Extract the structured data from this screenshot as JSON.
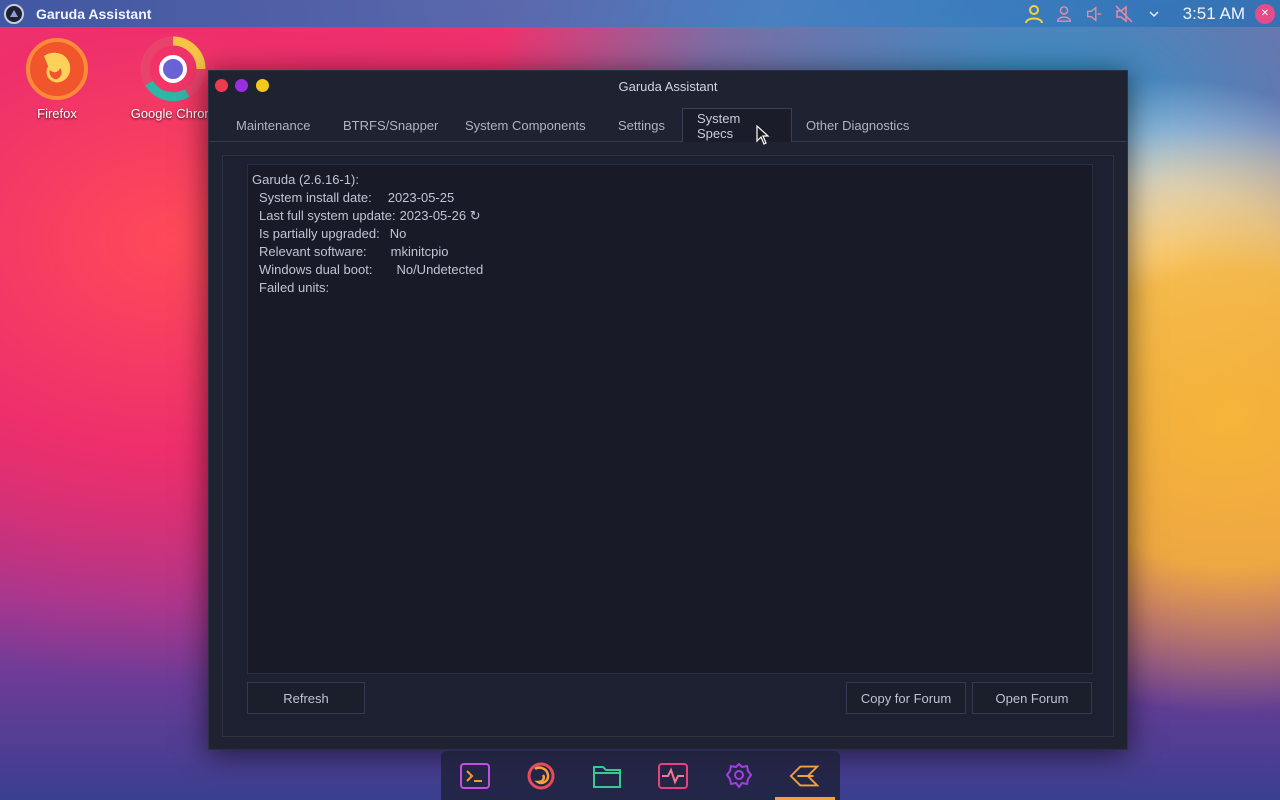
{
  "top_panel": {
    "active_app_title": "Garuda Assistant",
    "clock": "3:51 AM",
    "tray_icons": [
      "user-icon",
      "person-icon",
      "volume-mute-icon",
      "speaker-muted-icon",
      "chevron-down-icon"
    ]
  },
  "desktop": {
    "icons": [
      {
        "label": "Firefox",
        "icon": "firefox-icon"
      },
      {
        "label": "Google Chrom",
        "icon": "chrome-icon"
      }
    ]
  },
  "window": {
    "title": "Garuda Assistant",
    "tabs": [
      {
        "label": "Maintenance"
      },
      {
        "label": "BTRFS/Snapper"
      },
      {
        "label": "System Components"
      },
      {
        "label": "Settings"
      },
      {
        "label": "System Specs",
        "active": true
      },
      {
        "label": "Other Diagnostics"
      }
    ],
    "specs": {
      "header": "Garuda (2.6.16-1):",
      "install_date_label": "System install date:",
      "install_date_value": "2023-05-25",
      "last_update_label": "Last full system update:",
      "last_update_value": "2023-05-26 ↻",
      "partial_label": "Is partially upgraded:",
      "partial_value": "No",
      "software_label": "Relevant software:",
      "software_value": "mkinitcpio",
      "dualboot_label": "Windows dual boot:",
      "dualboot_value": "No/Undetected",
      "failed_label": "Failed units:"
    },
    "buttons": {
      "refresh": "Refresh",
      "copy_forum": "Copy for Forum",
      "open_forum": "Open Forum"
    }
  },
  "dock": {
    "items": [
      "terminal-icon",
      "firefox-icon",
      "files-icon",
      "system-monitor-icon",
      "settings-icon",
      "garuda-icon"
    ]
  },
  "colors": {
    "window_bg": "#1f2230",
    "text": "#c0c4d2",
    "accent": "#f0a13c"
  }
}
